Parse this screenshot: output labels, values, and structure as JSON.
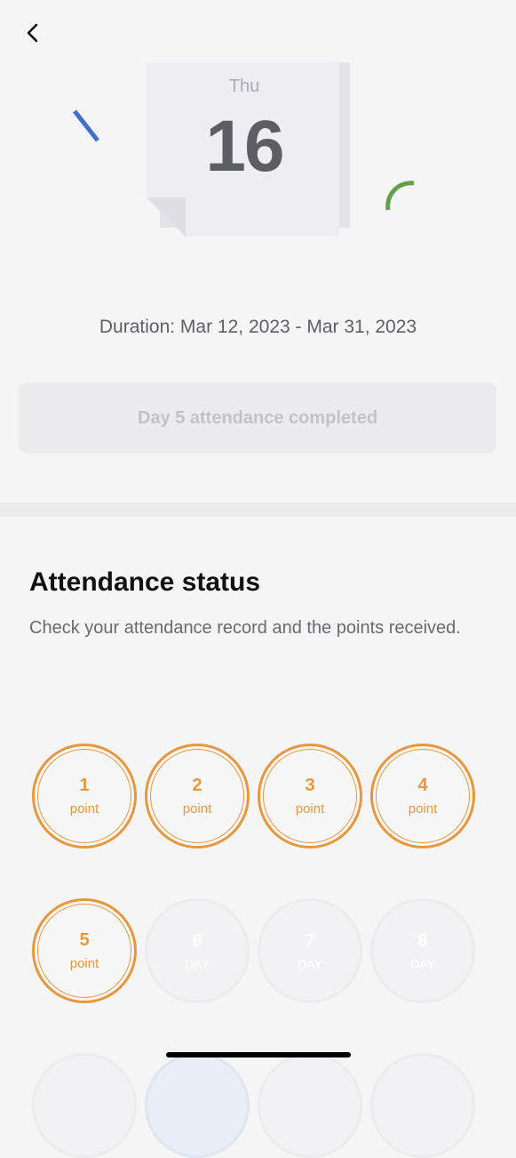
{
  "header": {
    "back_icon": "chevron-left-icon"
  },
  "calendar": {
    "day": "Thu",
    "date": "16"
  },
  "duration": "Duration: Mar 12, 2023 - Mar 31, 2023",
  "status_button": "Day 5 attendance completed",
  "attendance": {
    "title": "Attendance status",
    "description": "Check your attendance record and the points received.",
    "days": [
      {
        "number": "1",
        "label": "point",
        "completed": true
      },
      {
        "number": "2",
        "label": "point",
        "completed": true
      },
      {
        "number": "3",
        "label": "point",
        "completed": true
      },
      {
        "number": "4",
        "label": "point",
        "completed": true
      },
      {
        "number": "5",
        "label": "point",
        "completed": true
      },
      {
        "number": "6",
        "label": "DAY",
        "completed": false
      },
      {
        "number": "7",
        "label": "DAY",
        "completed": false
      },
      {
        "number": "8",
        "label": "DAY",
        "completed": false
      }
    ]
  },
  "colors": {
    "accent": "#e8973c",
    "deco_blue": "#3e6fd1",
    "deco_green": "#62a04a"
  }
}
